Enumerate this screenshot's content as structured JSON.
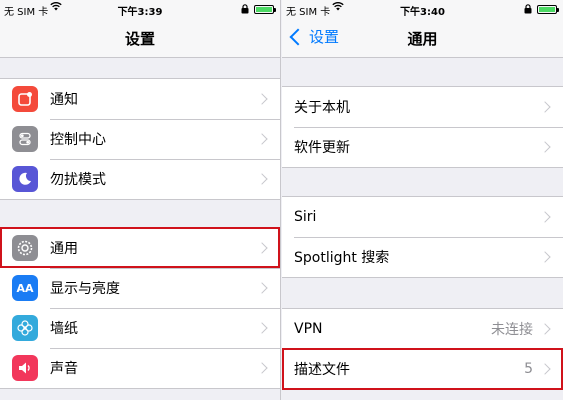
{
  "left": {
    "status": {
      "carrier": "无 SIM 卡",
      "time": "下午3:39"
    },
    "nav_title": "设置",
    "group1": [
      {
        "label": "通知",
        "icon": "notifications-icon",
        "color": "#f44a3b"
      },
      {
        "label": "控制中心",
        "icon": "control-center-icon",
        "color": "#8e8e93"
      },
      {
        "label": "勿扰模式",
        "icon": "do-not-disturb-icon",
        "color": "#5856d6"
      }
    ],
    "group2": [
      {
        "label": "通用",
        "icon": "gear-icon",
        "color": "#8e8e93"
      },
      {
        "label": "显示与亮度",
        "icon": "display-brightness-icon",
        "color": "#1a7cf4"
      },
      {
        "label": "墙纸",
        "icon": "wallpaper-icon",
        "color": "#33aadc"
      },
      {
        "label": "声音",
        "icon": "sound-icon",
        "color": "#f2375b"
      }
    ],
    "display_icon_text": "AA"
  },
  "right": {
    "status": {
      "carrier": "无 SIM 卡",
      "time": "下午3:40"
    },
    "nav_title": "通用",
    "back_label": "设置",
    "group1": [
      "关于本机",
      "软件更新"
    ],
    "group2": [
      "Siri",
      "Spotlight 搜索"
    ],
    "group3": [
      {
        "label": "VPN",
        "detail": "未连接"
      },
      {
        "label": "描述文件",
        "detail": "5"
      }
    ]
  },
  "colors": {
    "accent": "#007aff",
    "highlight": "#d0121b"
  }
}
